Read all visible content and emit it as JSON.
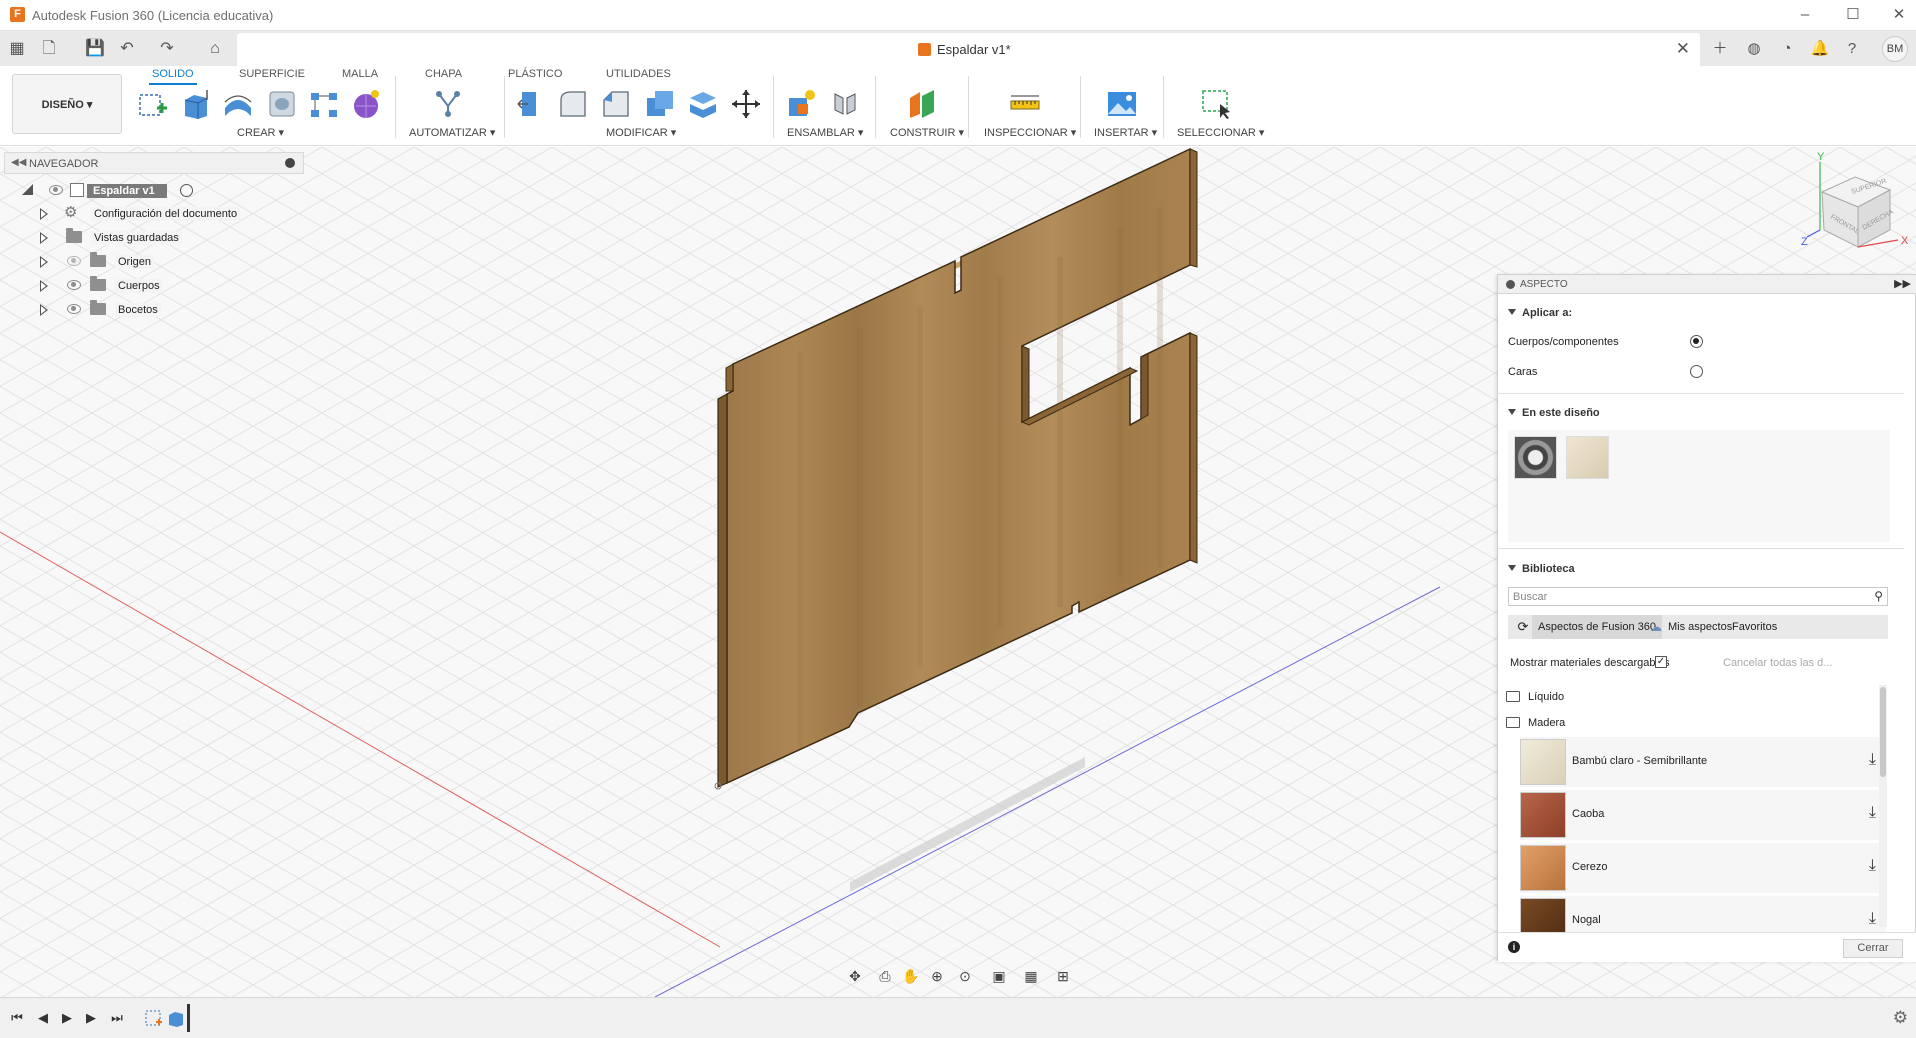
{
  "window": {
    "title": "Autodesk Fusion 360 (Licencia educativa)",
    "minimize": "–",
    "maximize": "☐",
    "close": "✕"
  },
  "document": {
    "tab_title": "Espaldar v1*",
    "user_initials": "BM"
  },
  "ribbon": {
    "workspace": "DISEÑO ▾",
    "tabs": [
      "SOLIDO",
      "SUPERFICIE",
      "MALLA",
      "CHAPA",
      "PLÁSTICO",
      "UTILIDADES"
    ],
    "active_tab": "SOLIDO",
    "groups": [
      "CREAR ▾",
      "AUTOMATIZAR ▾",
      "MODIFICAR ▾",
      "ENSAMBLAR ▾",
      "CONSTRUIR ▾",
      "INSPECCIONAR ▾",
      "INSERTAR ▾",
      "SELECCIONAR ▾"
    ]
  },
  "navigator": {
    "title": "NAVEGADOR",
    "root": "Espaldar v1",
    "items": [
      {
        "label": "Configuración del documento",
        "icon": "gear-icon"
      },
      {
        "label": "Vistas guardadas",
        "icon": "folder-icon"
      },
      {
        "label": "Origen",
        "icon": "folder-icon"
      },
      {
        "label": "Cuerpos",
        "icon": "folder-icon"
      },
      {
        "label": "Bocetos",
        "icon": "folder-icon"
      }
    ]
  },
  "viewcube": {
    "faces": [
      "SUPERIOR",
      "FRONTAL",
      "DERECHA"
    ],
    "axes": [
      "Y",
      "Z",
      "X"
    ]
  },
  "aspect_panel": {
    "title": "ASPECTO",
    "apply_to_title": "Aplicar a:",
    "apply_options": [
      {
        "label": "Cuerpos/componentes",
        "checked": true
      },
      {
        "label": "Caras",
        "checked": false
      }
    ],
    "in_design_title": "En este diseño",
    "library_title": "Biblioteca",
    "search_placeholder": "Buscar",
    "library_tabs": [
      "Aspectos de Fusion 360",
      "Mis aspectos",
      "Favoritos"
    ],
    "show_downloadable": "Mostrar materiales descargables",
    "cancel_all": "Cancelar todas las d...",
    "categories": [
      "Líquido",
      "Madera"
    ],
    "materials": [
      {
        "label": "Bambú claro - Semibrillante",
        "color": "#e9e2cf"
      },
      {
        "label": "Caoba",
        "color": "#a5553a"
      },
      {
        "label": "Cerezo",
        "color": "#d18a4f"
      },
      {
        "label": "Nogal",
        "color": "#6e4220"
      }
    ],
    "close_label": "Cerrar"
  },
  "colors": {
    "accent": "#0d7fd5",
    "wood_face": "#a8824f",
    "wood_edge": "#8a6535"
  }
}
